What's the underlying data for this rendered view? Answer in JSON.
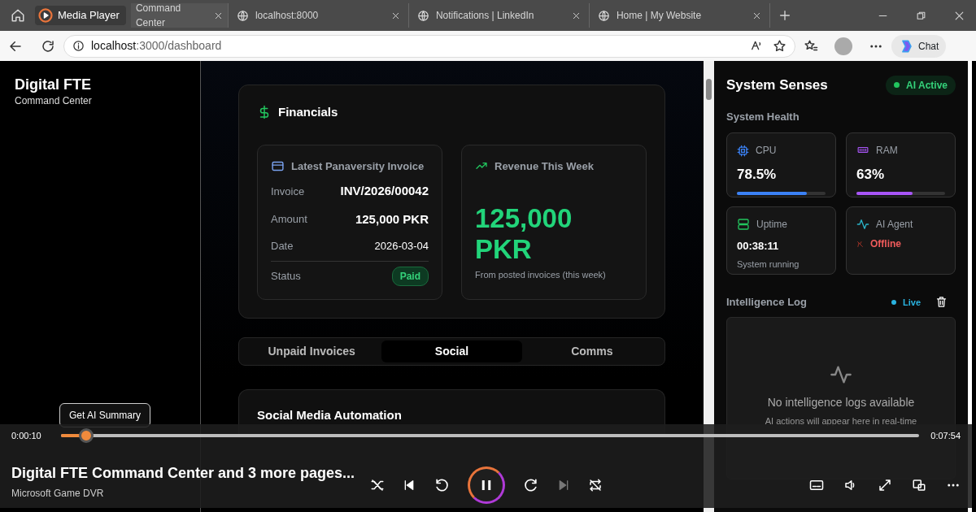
{
  "browser": {
    "app_title": "Media Player",
    "tabs": [
      {
        "label": "Command Center",
        "selected": true
      },
      {
        "label": "localhost:8000",
        "selected": false
      },
      {
        "label": "Notifications | LinkedIn",
        "selected": false
      },
      {
        "label": "Home | My Website",
        "selected": false
      }
    ],
    "url_host": "localhost",
    "url_path": ":3000/dashboard",
    "chat_label": "Chat"
  },
  "sidebar": {
    "title": "Digital FTE",
    "subtitle": "Command Center"
  },
  "financials": {
    "title": "Financials",
    "invoice_card": {
      "title": "Latest Panaversity Invoice",
      "rows": [
        {
          "label": "Invoice",
          "value": "INV/2026/00042",
          "emphasis": true
        },
        {
          "label": "Amount",
          "value": "125,000 PKR",
          "emphasis": true
        },
        {
          "label": "Date",
          "value": "2026-03-04",
          "emphasis": false
        }
      ],
      "status": {
        "label": "Status",
        "value": "Paid"
      }
    },
    "revenue_card": {
      "title": "Revenue This Week",
      "amount": "125,000 PKR",
      "note": "From posted invoices (this week)"
    }
  },
  "tabs": [
    {
      "label": "Unpaid Invoices",
      "selected": false
    },
    {
      "label": "Social",
      "selected": true
    },
    {
      "label": "Comms",
      "selected": false
    }
  ],
  "social": {
    "title": "Social Media Automation"
  },
  "system": {
    "title": "System Senses",
    "badge": "AI Active",
    "health_title": "System Health",
    "metrics": [
      {
        "kind": "meter",
        "label": "CPU",
        "value": "78.5%",
        "level": 0.785,
        "color": "#3b82f6"
      },
      {
        "kind": "meter",
        "label": "RAM",
        "value": "63%",
        "level": 0.63,
        "color": "#a855f7"
      },
      {
        "kind": "text",
        "label": "Uptime",
        "value": "00:38:11",
        "note": "System running"
      },
      {
        "kind": "status",
        "label": "AI Agent",
        "status": "Offline"
      }
    ],
    "log": {
      "title": "Intelligence Log",
      "live": "Live",
      "empty_title": "No intelligence logs available",
      "empty_note": "AI actions will appear here in real-time"
    }
  },
  "player": {
    "tooltip": "Get AI Summary",
    "elapsed": "0:00:10",
    "duration": "0:07:54",
    "level": 0.03,
    "title": "Digital FTE Command Center and 3 more pages...",
    "source": "Microsoft Game DVR",
    "playing": true
  }
}
